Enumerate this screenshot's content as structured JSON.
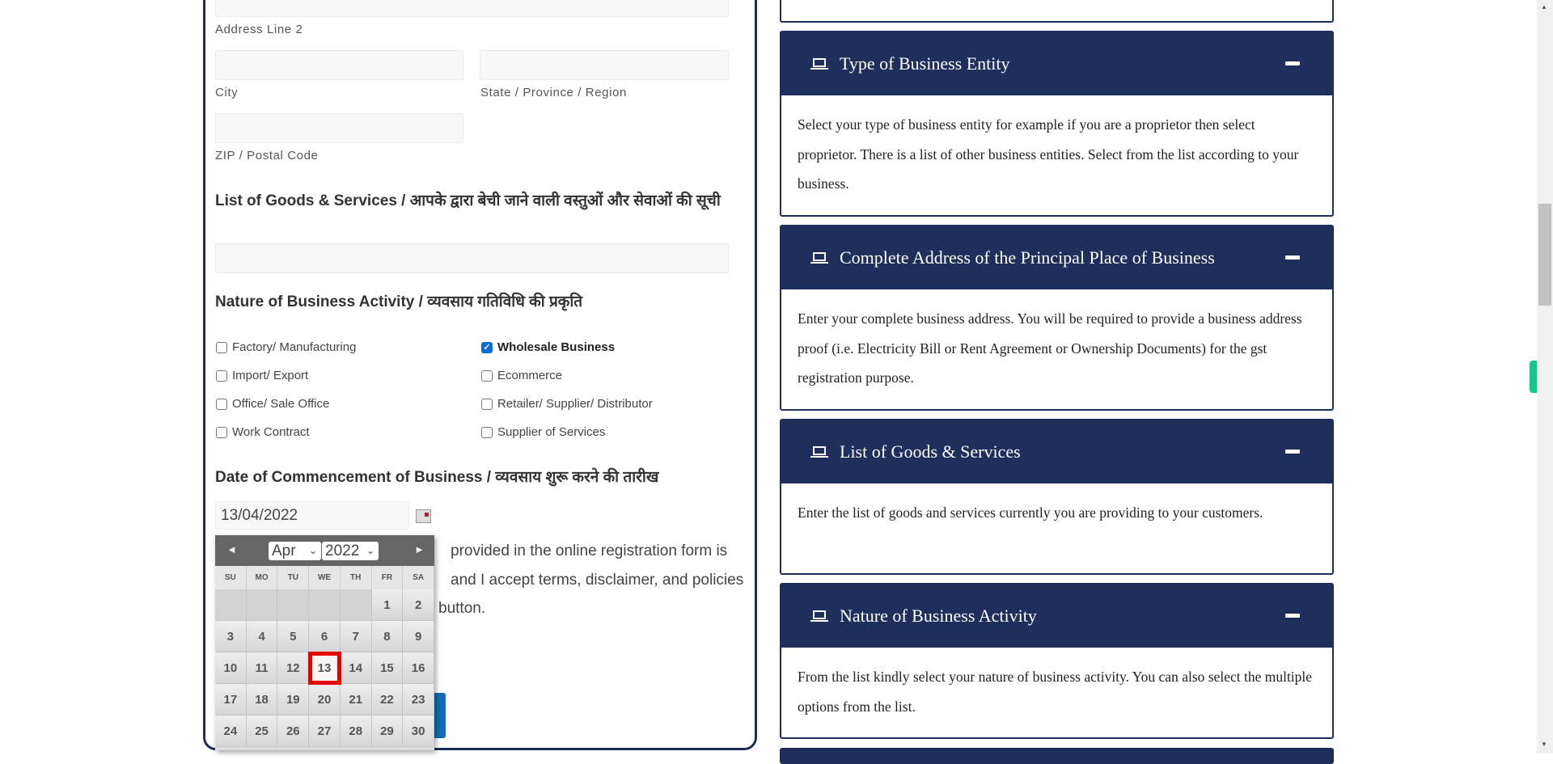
{
  "form": {
    "address_line2_label": "Address Line 2",
    "city_label": "City",
    "state_label": "State / Province / Region",
    "zip_label": "ZIP / Postal Code",
    "goods_heading": "List of Goods & Services / आपके द्वारा बेची जाने वाली वस्तुओं और सेवाओं की सूची",
    "nature_heading": "Nature of Business Activity / व्यवसाय गतिविधि की प्रकृति",
    "activities": [
      {
        "label": "Factory/ Manufacturing",
        "checked": false
      },
      {
        "label": "Wholesale Business",
        "checked": true
      },
      {
        "label": "Import/ Export",
        "checked": false
      },
      {
        "label": "Ecommerce",
        "checked": false
      },
      {
        "label": "Office/ Sale Office",
        "checked": false
      },
      {
        "label": "Retailer/ Supplier/ Distributor",
        "checked": false
      },
      {
        "label": "Work Contract",
        "checked": false
      },
      {
        "label": "Supplier of Services",
        "checked": false
      }
    ],
    "date_heading": "Date of Commencement of Business / व्यवसाय शुरू करने की तारीख",
    "date_value": "13/04/2022",
    "declaration_lines": [
      "provided in the online registration form is",
      "and I accept terms, disclaimer, and policies",
      "button."
    ]
  },
  "calendar": {
    "month": "Apr",
    "year": "2022",
    "prev": "◄",
    "next": "►",
    "weekdays": [
      "SU",
      "MO",
      "TU",
      "WE",
      "TH",
      "FR",
      "SA"
    ],
    "leading_blanks": 5,
    "days": 30,
    "selected_day": 13
  },
  "info_boxes": [
    {
      "title": "Type of Business Entity",
      "body": "Select your type of business entity for example if you are a proprietor then select proprietor. There is a list of other business entities. Select from the list according to your business."
    },
    {
      "title": "Complete Address of the Principal Place of Business",
      "body": "Enter your complete business address. You will be required to provide a business address proof (i.e. Electricity Bill or Rent Agreement or Ownership Documents) for the gst registration purpose."
    },
    {
      "title": "List of Goods & Services",
      "body": "Enter the list of goods and services currently you are providing to your customers."
    },
    {
      "title": "Nature of Business Activity",
      "body": "From the list kindly select your nature of business activity. You can also select the multiple options from the list."
    }
  ],
  "colors": {
    "navy": "#1f2f5c",
    "selected_outline": "#e60000",
    "checkbox": "#0b6bd6",
    "submit_button": "#0d6eb5",
    "side_tab": "#10c98f"
  }
}
